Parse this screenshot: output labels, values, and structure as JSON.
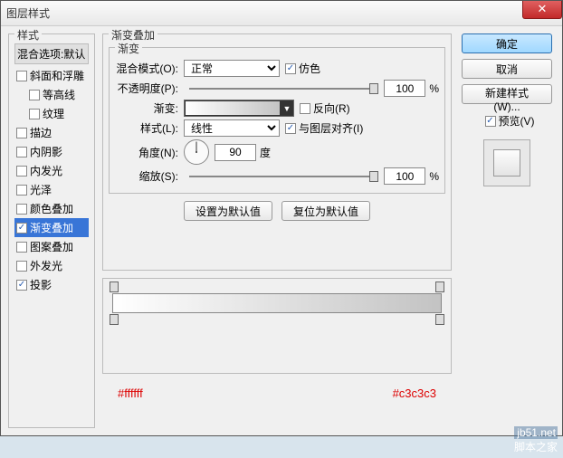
{
  "window": {
    "title": "图层样式"
  },
  "stylesPanel": {
    "title": "样式",
    "defaultItem": "混合选项:默认",
    "items": [
      {
        "label": "斜面和浮雕",
        "checked": false,
        "indent": false
      },
      {
        "label": "等高线",
        "checked": false,
        "indent": true
      },
      {
        "label": "纹理",
        "checked": false,
        "indent": true
      },
      {
        "label": "描边",
        "checked": false,
        "indent": false
      },
      {
        "label": "内阴影",
        "checked": false,
        "indent": false
      },
      {
        "label": "内发光",
        "checked": false,
        "indent": false
      },
      {
        "label": "光泽",
        "checked": false,
        "indent": false
      },
      {
        "label": "颜色叠加",
        "checked": false,
        "indent": false
      },
      {
        "label": "渐变叠加",
        "checked": true,
        "indent": false,
        "active": true
      },
      {
        "label": "图案叠加",
        "checked": false,
        "indent": false
      },
      {
        "label": "外发光",
        "checked": false,
        "indent": false
      },
      {
        "label": "投影",
        "checked": true,
        "indent": false
      }
    ]
  },
  "gradientOverlay": {
    "title": "渐变叠加",
    "innerTitle": "渐变",
    "blendModeLabel": "混合模式(O):",
    "blendModeValue": "正常",
    "ditherLabel": "仿色",
    "ditherChecked": true,
    "opacityLabel": "不透明度(P):",
    "opacityValue": "100",
    "opacityUnit": "%",
    "gradientLabel": "渐变:",
    "reverseLabel": "反向(R)",
    "reverseChecked": false,
    "styleLabel": "样式(L):",
    "styleValue": "线性",
    "alignLabel": "与图层对齐(I)",
    "alignChecked": true,
    "angleLabel": "角度(N):",
    "angleValue": "90",
    "angleUnit": "度",
    "scaleLabel": "缩放(S):",
    "scaleValue": "100",
    "scaleUnit": "%",
    "makeDefault": "设置为默认值",
    "resetDefault": "复位为默认值"
  },
  "gradientStops": {
    "startHex": "#ffffff",
    "endHex": "#c3c3c3"
  },
  "rightPanel": {
    "ok": "确定",
    "cancel": "取消",
    "newStyle": "新建样式(W)...",
    "previewLabel": "预览(V)",
    "previewChecked": true
  },
  "watermark": {
    "url": "jb51.net",
    "text": "脚本之家"
  }
}
